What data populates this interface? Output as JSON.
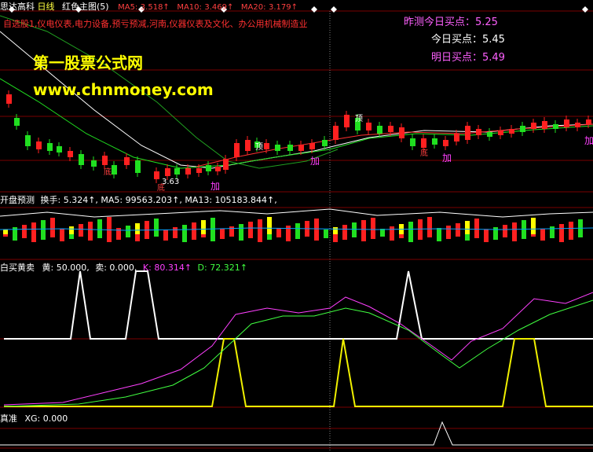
{
  "top_bar": {
    "stock_name": "思达高科",
    "period": "日线",
    "indicator_name": "红色主图(5)",
    "ma5_label": "MA5:",
    "ma5_value": "3.518↑",
    "ma10_label": "MA10:",
    "ma10_value": "3.469↑",
    "ma20_label": "MA20:",
    "ma20_value": "3.179↑"
  },
  "sector_text": "自选股1,仪电仪表,电力设备,预亏预减,河南,仪器仪表及文化、办公用机械制造业",
  "watermark": {
    "line1": "第一股票公式网",
    "line2": "www.chnmoney.com"
  },
  "buy_points": {
    "yesterday": "昨测今日买点：5.25",
    "today": "今日买点：5.45",
    "tomorrow": "明日买点：5.49"
  },
  "main_annotations": {
    "low_price": "3.63",
    "jia": "加",
    "ding": "顶",
    "di": "底"
  },
  "panel2": {
    "title": "开盘预测",
    "params": "换手: 5.324↑, MA5: 99563.203↑, MA13: 105183.844↑,"
  },
  "panel3": {
    "title": "白买黄卖",
    "huang": "黄: 50.000,",
    "mai": "卖: 0.000,",
    "k": "K: 80.314↑",
    "d": "D: 72.321↑"
  },
  "panel4": {
    "title": "真准",
    "xg": "XG: 0.000"
  },
  "colors": {
    "up": "#ff2020",
    "down": "#20e020",
    "grid": "#7a0000",
    "white": "#ffffff",
    "yellow": "#f0f000",
    "magenta": "#ff40ff",
    "green": "#20e020",
    "cyan": "#40c0c0"
  }
}
